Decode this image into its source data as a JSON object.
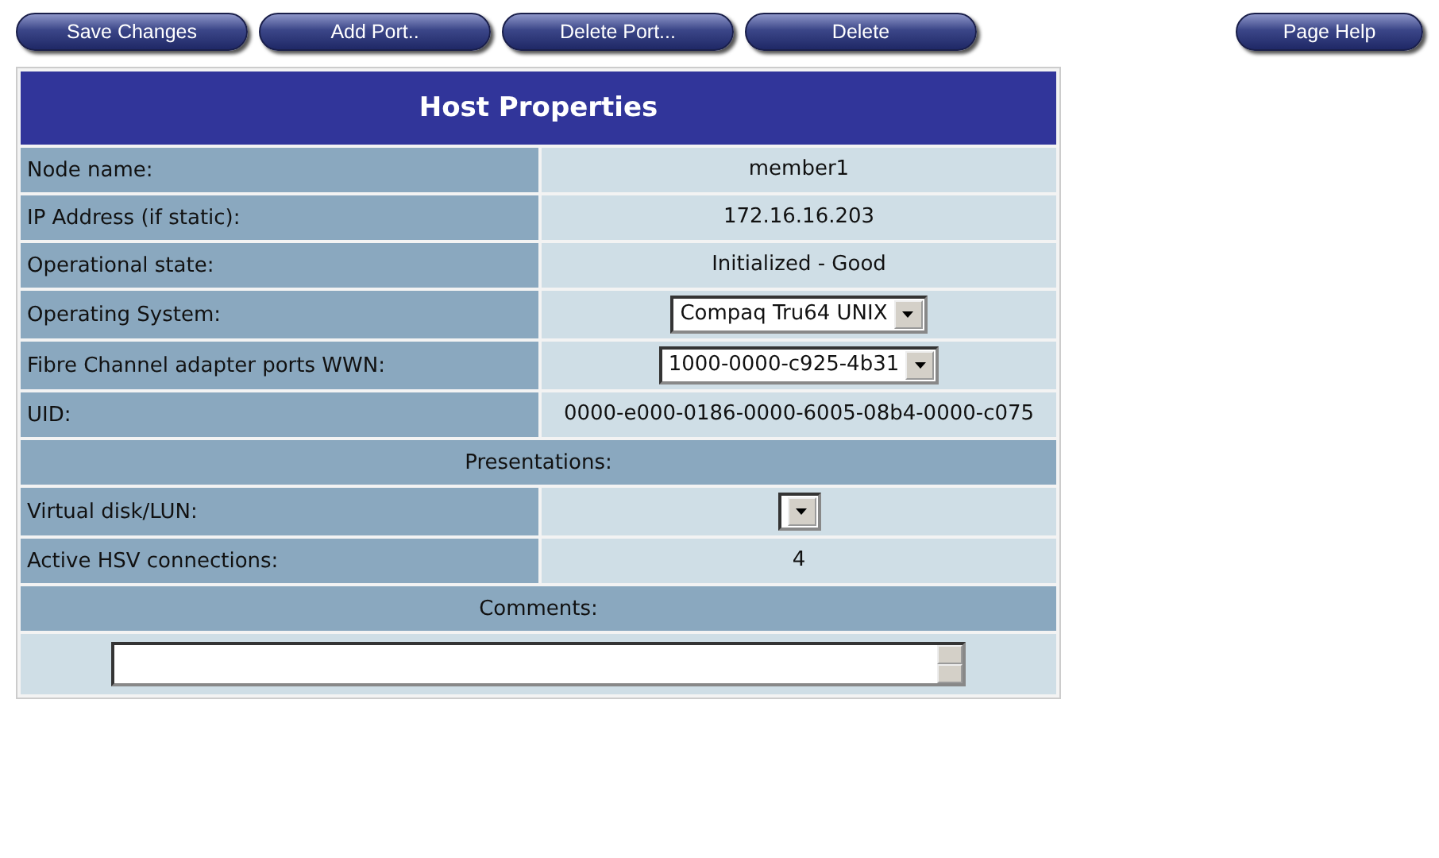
{
  "toolbar": {
    "buttons": [
      "Save Changes",
      "Add Port..",
      "Delete Port...",
      "Delete"
    ],
    "help_button": "Page Help"
  },
  "table": {
    "title": "Host Properties",
    "rows": [
      {
        "kind": "field",
        "label": "Node name:",
        "value": "member1"
      },
      {
        "kind": "field",
        "label": "IP Address (if static):",
        "value": "172.16.16.203"
      },
      {
        "kind": "field",
        "label": "Operational state:",
        "value": "Initialized - Good"
      },
      {
        "kind": "select",
        "label": "Operating System:",
        "value": "Compaq Tru64 UNIX"
      },
      {
        "kind": "select",
        "label": "Fibre Channel adapter ports WWN:",
        "value": "1000-0000-c925-4b31"
      },
      {
        "kind": "field",
        "label": "UID:",
        "value": "0000-e000-0186-0000-6005-08b4-0000-c075"
      },
      {
        "kind": "section",
        "label": "Presentations:"
      },
      {
        "kind": "select",
        "label": "Virtual disk/LUN:"
      },
      {
        "kind": "field",
        "label": "Active HSV connections:",
        "value": "4"
      },
      {
        "kind": "section",
        "label": "Comments:"
      },
      {
        "kind": "textarea"
      }
    ]
  }
}
